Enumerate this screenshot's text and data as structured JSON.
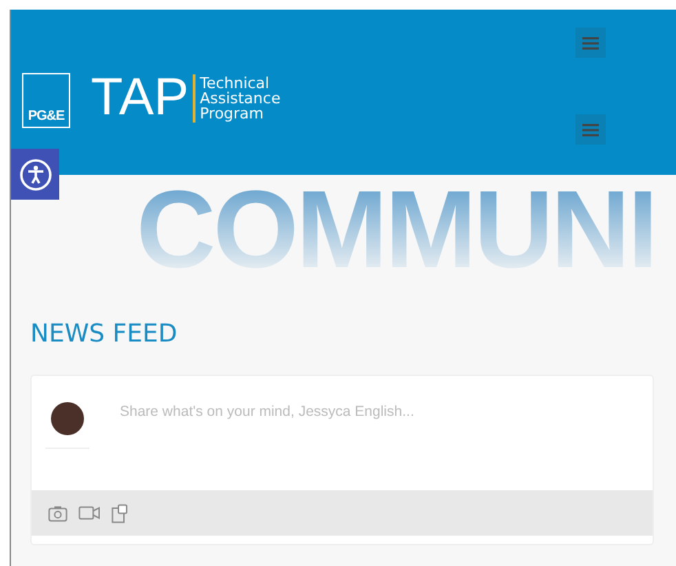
{
  "header": {
    "logo_mark": "PG&E",
    "brand": "TAP",
    "tagline": [
      "Technical",
      "Assistance",
      "Program"
    ]
  },
  "hero": {
    "title": "COMMUNI"
  },
  "news_feed": {
    "title": "NEWS FEED",
    "composer": {
      "placeholder": "Share what's on your mind, Jessyca English..."
    }
  }
}
